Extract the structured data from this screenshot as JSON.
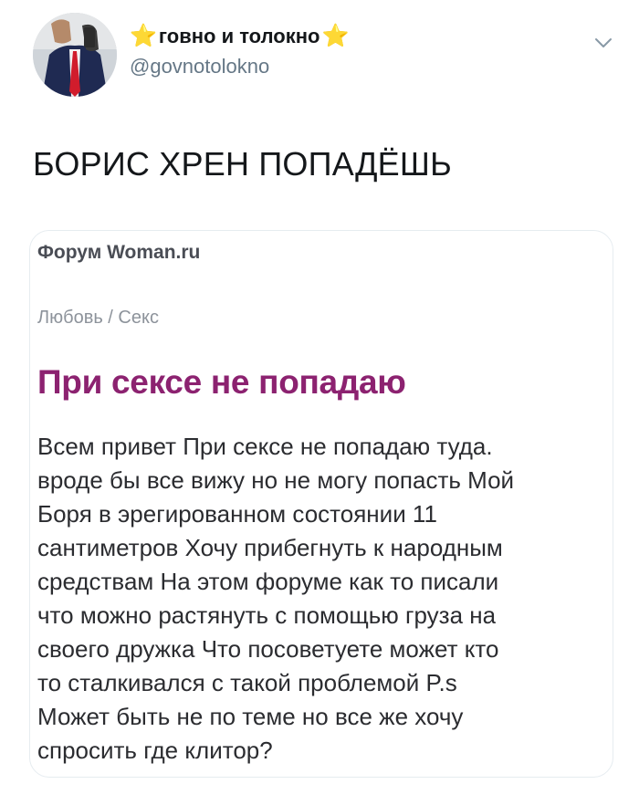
{
  "tweet": {
    "display_name": "говно и толокно",
    "handle": "@govnotolokno",
    "text": "БОРИС ХРЕН ПОПАДЁШЬ",
    "name_star_icon": "star-emoji",
    "menu_icon": "chevron-down-icon"
  },
  "screenshot_card": {
    "site_name": "Форум Woman.ru",
    "breadcrumb": "Любовь / Секс",
    "title": "При сексе не попадаю",
    "body_lines": [
      "Всем привет При сексе не попадаю туда.",
      "вроде бы все вижу но не могу попасть Мой",
      "Боря в эрегированном состоянии 11",
      "сантиметров Хочу прибегнуть к народным",
      "средствам На этом форуме как то писали",
      "что можно растянуть с помощью груза на",
      "своего дружка Что посоветуете может кто",
      "то сталкивался с такой проблемой P.s",
      "Может быть не по теме но все же хочу",
      "спросить где клитор?"
    ]
  },
  "colors": {
    "title_accent": "#8c2270",
    "handle_gray": "#657786",
    "star_yellow": "#ffcc33"
  }
}
